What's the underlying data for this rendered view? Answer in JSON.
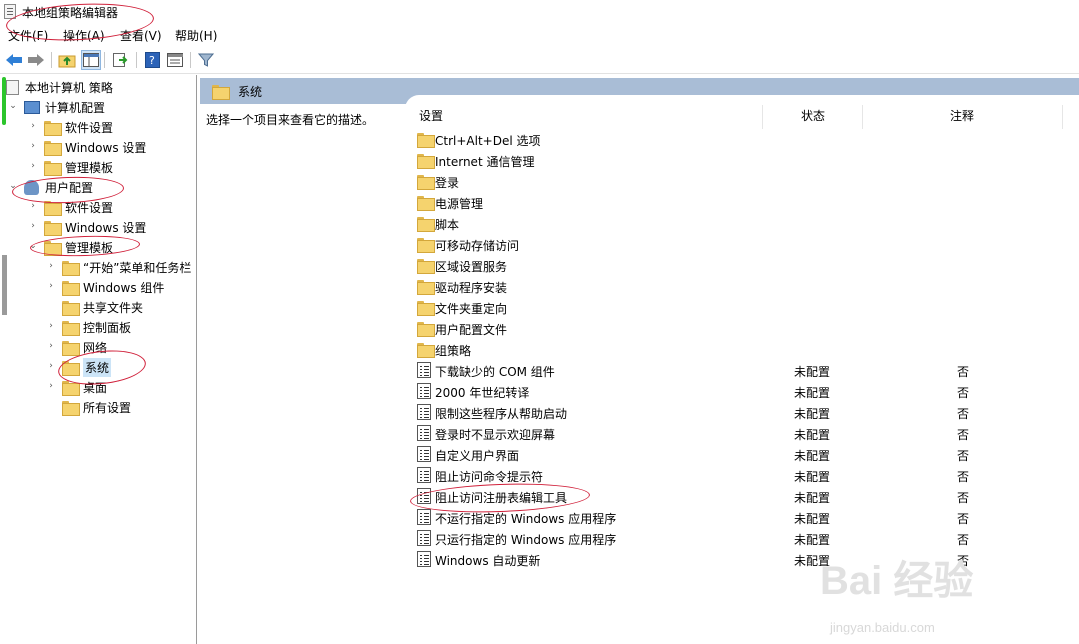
{
  "window": {
    "title": "本地组策略编辑器"
  },
  "menu": [
    {
      "label": "文件(F)"
    },
    {
      "label": "操作(A)"
    },
    {
      "label": "查看(V)"
    },
    {
      "label": "帮助(H)"
    }
  ],
  "toolbar": [
    "back-icon",
    "forward-icon",
    "up-folder-icon",
    "show-hide-tree-icon",
    "export-list-icon",
    "help-icon",
    "properties-icon",
    "filter-icon"
  ],
  "tree": {
    "root": "本地计算机 策略",
    "computer_config": "计算机配置",
    "cc_software": "软件设置",
    "cc_windows": "Windows 设置",
    "cc_admin": "管理模板",
    "user_config": "用户配置",
    "uc_software": "软件设置",
    "uc_windows": "Windows 设置",
    "uc_admin": "管理模板",
    "start_menu": "“开始”菜单和任务栏",
    "win_components": "Windows 组件",
    "shared_folders": "共享文件夹",
    "control_panel": "控制面板",
    "network": "网络",
    "system": "系统",
    "desktop": "桌面",
    "all_settings": "所有设置"
  },
  "details": {
    "section_title": "系统",
    "description": "选择一个项目来查看它的描述。",
    "columns": {
      "setting": "设置",
      "state": "状态",
      "comment": "注释"
    },
    "folders": [
      "Ctrl+Alt+Del 选项",
      "Internet 通信管理",
      "登录",
      "电源管理",
      "脚本",
      "可移动存储访问",
      "区域设置服务",
      "驱动程序安装",
      "文件夹重定向",
      "用户配置文件",
      "组策略"
    ],
    "policies": [
      {
        "name": "下载缺少的 COM 组件",
        "state": "未配置",
        "comment": "否"
      },
      {
        "name": "2000 年世纪转译",
        "state": "未配置",
        "comment": "否"
      },
      {
        "name": "限制这些程序从帮助启动",
        "state": "未配置",
        "comment": "否"
      },
      {
        "name": "登录时不显示欢迎屏幕",
        "state": "未配置",
        "comment": "否"
      },
      {
        "name": "自定义用户界面",
        "state": "未配置",
        "comment": "否"
      },
      {
        "name": "阻止访问命令提示符",
        "state": "未配置",
        "comment": "否"
      },
      {
        "name": "阻止访问注册表编辑工具",
        "state": "未配置",
        "comment": "否"
      },
      {
        "name": "不运行指定的 Windows 应用程序",
        "state": "未配置",
        "comment": "否"
      },
      {
        "name": "只运行指定的 Windows 应用程序",
        "state": "未配置",
        "comment": "否"
      },
      {
        "name": "Windows 自动更新",
        "state": "未配置",
        "comment": "否"
      }
    ]
  },
  "watermark": {
    "brand": "Bai 经验",
    "url": "jingyan.baidu.com"
  },
  "colors": {
    "header_band": "#a9bdd6",
    "selection": "#cce4f7",
    "annotation": "#d0203a"
  }
}
